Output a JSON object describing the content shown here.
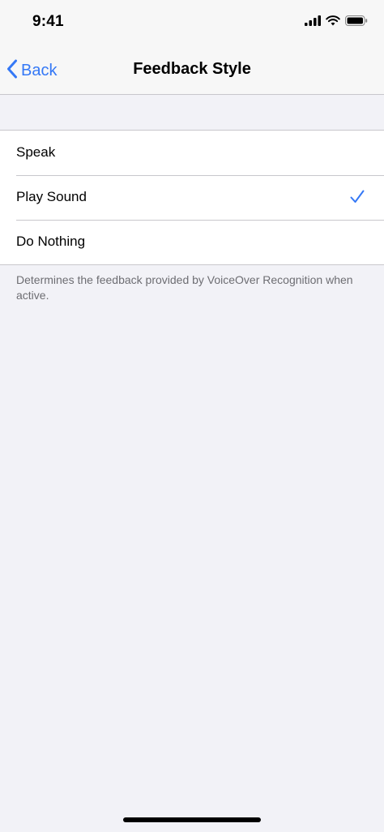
{
  "status_bar": {
    "time": "9:41",
    "icons": [
      "cellular-signal-icon",
      "wifi-icon",
      "battery-icon"
    ]
  },
  "nav": {
    "back_label": "Back",
    "back_icon": "chevron-left-icon",
    "title": "Feedback Style"
  },
  "options": [
    {
      "label": "Speak",
      "selected": false
    },
    {
      "label": "Play Sound",
      "selected": true
    },
    {
      "label": "Do Nothing",
      "selected": false
    }
  ],
  "footer": "Determines the feedback provided by VoiceOver Recognition when active.",
  "colors": {
    "accent": "#3478f6",
    "background": "#f2f2f7",
    "cell": "#ffffff",
    "separator": "#c8c7cc",
    "footer_text": "#6d6d72"
  }
}
